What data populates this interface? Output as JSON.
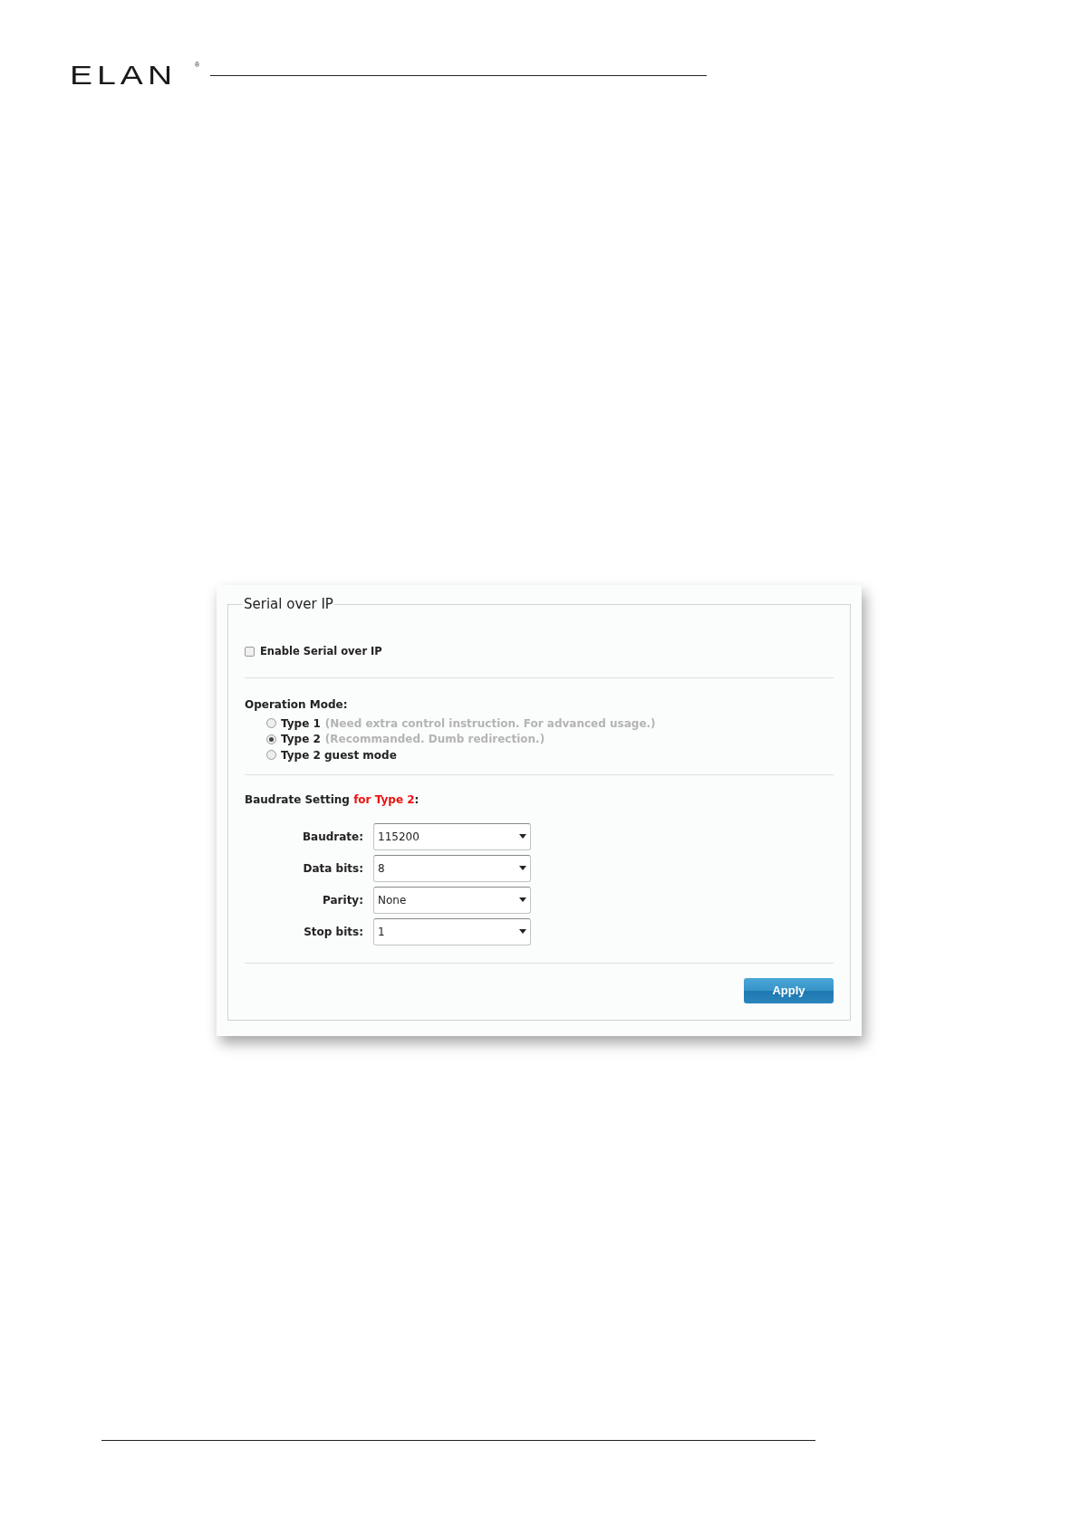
{
  "header": {
    "logo": "ELAN",
    "logo_mark": "®"
  },
  "panel": {
    "title": "Serial over IP",
    "enable": {
      "label": "Enable Serial over IP",
      "checked": false
    },
    "operation_mode": {
      "label": "Operation Mode:",
      "options": [
        {
          "label": "Type 1",
          "note": "(Need extra control instruction. For advanced usage.)",
          "selected": false
        },
        {
          "label": "Type 2",
          "note": "(Recommanded. Dumb redirection.)",
          "selected": true
        },
        {
          "label": "Type 2 guest mode",
          "selected": false
        }
      ]
    },
    "baudrate_setting": {
      "label": "Baudrate Setting",
      "highlight": "for Type 2",
      "suffix": ":"
    },
    "fields": [
      {
        "label": "Baudrate:",
        "value": "115200"
      },
      {
        "label": "Data bits:",
        "value": "8"
      },
      {
        "label": "Parity:",
        "value": "None"
      },
      {
        "label": "Stop bits:",
        "value": "1"
      }
    ],
    "apply": "Apply"
  }
}
